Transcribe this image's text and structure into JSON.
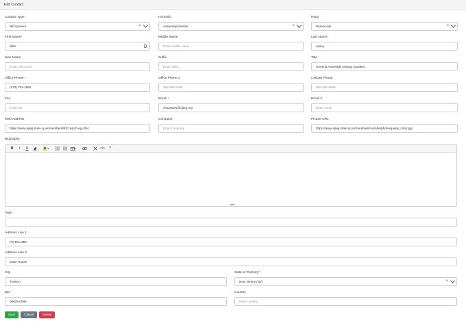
{
  "header": {
    "title": "Edit Contact"
  },
  "fields": {
    "contact_type": {
      "label": "Contact Type",
      "req": "*",
      "value": "Bill Sponsor"
    },
    "honorific": {
      "label": "Honorific",
      "value": "Assemblymember"
    },
    "party": {
      "label": "Party",
      "value": "Democrats"
    },
    "first_name": {
      "label": "First Name",
      "req": "*",
      "value": "Nilla"
    },
    "middle_name": {
      "label": "Middle Name",
      "placeholder": "Enter middle name"
    },
    "last_name": {
      "label": "Last Name",
      "req": "*",
      "value": "Jasey"
    },
    "nick_name": {
      "label": "Nick Name",
      "placeholder": "Enter nick name"
    },
    "suffix": {
      "label": "Suffix",
      "placeholder": "Enter suffix"
    },
    "title": {
      "label": "Title",
      "value": "General Assembly Deputy Speaker"
    },
    "office_phone": {
      "label": "Office Phone",
      "req": " *",
      "value": "(973) 762-1886"
    },
    "office_phone_2": {
      "label": "Office Phone 2",
      "placeholder": "999-999-9999"
    },
    "cellular_phone": {
      "label": "Cellular Phone",
      "placeholder": "999-999-9999"
    },
    "fax": {
      "label": "Fax",
      "placeholder": "Enter fax"
    },
    "email": {
      "label": "Email",
      "req": " *",
      "value": "AswJasey@njleg.org"
    },
    "email_2": {
      "label": "Email 2",
      "placeholder": "Enter email"
    },
    "web_address": {
      "label": "Web Address",
      "value": "https://www.njleg.state.nj.us/members/BIO.asp?Leg=284"
    },
    "company": {
      "label": "Company",
      "placeholder": "Enter company"
    },
    "picture_url": {
      "label": "Picture URL",
      "value": "https://www.njleg.state.nj.us/members/memberphotos/jasey_color.jpg"
    },
    "biography": {
      "label": "Biography"
    },
    "tags": {
      "label": "Tags"
    },
    "address_1": {
      "label": "Address Line 1",
      "value": "PO Box 356"
    },
    "address_2": {
      "label": "Address Line 2",
      "value": "State House"
    },
    "city": {
      "label": "City",
      "value": "Trenton"
    },
    "state": {
      "label": "State or Territory",
      "req": "*",
      "value": "New Jersey (NJ)"
    },
    "zip": {
      "label": "Zip",
      "req": " *",
      "value": "08625-0098"
    },
    "country": {
      "label": "Country",
      "placeholder": "Enter country"
    }
  },
  "toolbar_icons": [
    "bold-icon",
    "italic-icon",
    "underline-icon",
    "eraser-icon",
    "font-color-icon",
    "bullet-list-icon",
    "numbered-list-icon",
    "table-icon",
    "link-icon",
    "fullscreen-icon",
    "code-view-icon",
    "help-icon"
  ],
  "buttons": {
    "save": "Save",
    "cancel": "Cancel",
    "delete": "Delete"
  }
}
